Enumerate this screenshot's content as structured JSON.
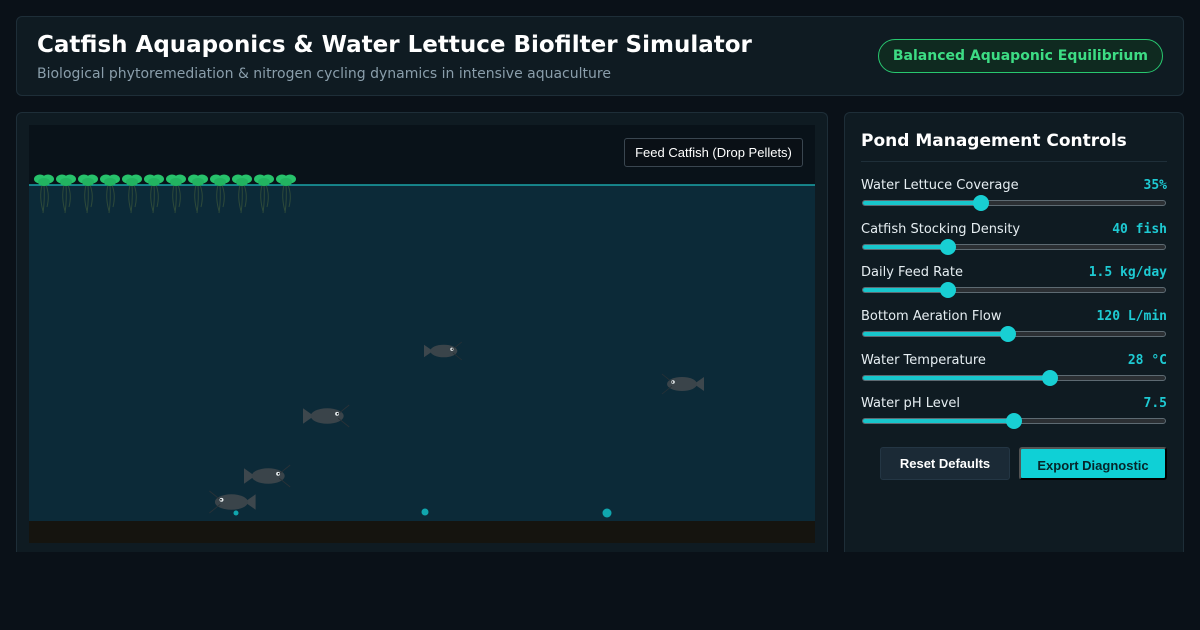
{
  "header": {
    "title": "Catfish Aquaponics & Water Lettuce Biofilter Simulator",
    "subtitle": "Biological phytoremediation & nitrogen cycling dynamics in intensive aquaculture",
    "status_badge": "Balanced Aquaponic Equilibrium",
    "status_color": "#3ddc84"
  },
  "simulation": {
    "feed_button_label": "Feed Catfish (Drop Pellets)",
    "water_lettuce_plants": 12,
    "fish_visible": 5,
    "colors": {
      "water": "#0c2a38",
      "sediment": "#15140f",
      "surface": "#1aa3a8",
      "plant": "#27c26b",
      "fish": "#3a444a",
      "particle": "#10a6ae"
    }
  },
  "controls": {
    "title": "Pond Management Controls",
    "sliders": [
      {
        "label": "Water Lettuce Coverage",
        "display": "35%",
        "fraction": 0.39
      },
      {
        "label": "Catfish Stocking Density",
        "display": "40 fish",
        "fraction": 0.28
      },
      {
        "label": "Daily Feed Rate",
        "display": "1.5 kg/day",
        "fraction": 0.28
      },
      {
        "label": "Bottom Aeration Flow",
        "display": "120 L/min",
        "fraction": 0.48
      },
      {
        "label": "Water Temperature",
        "display": "28 °C",
        "fraction": 0.62
      },
      {
        "label": "Water pH Level",
        "display": "7.5",
        "fraction": 0.5
      }
    ],
    "reset_label": "Reset Defaults",
    "export_label": "Export Diagnostic",
    "accent_color": "#18c6cc"
  }
}
